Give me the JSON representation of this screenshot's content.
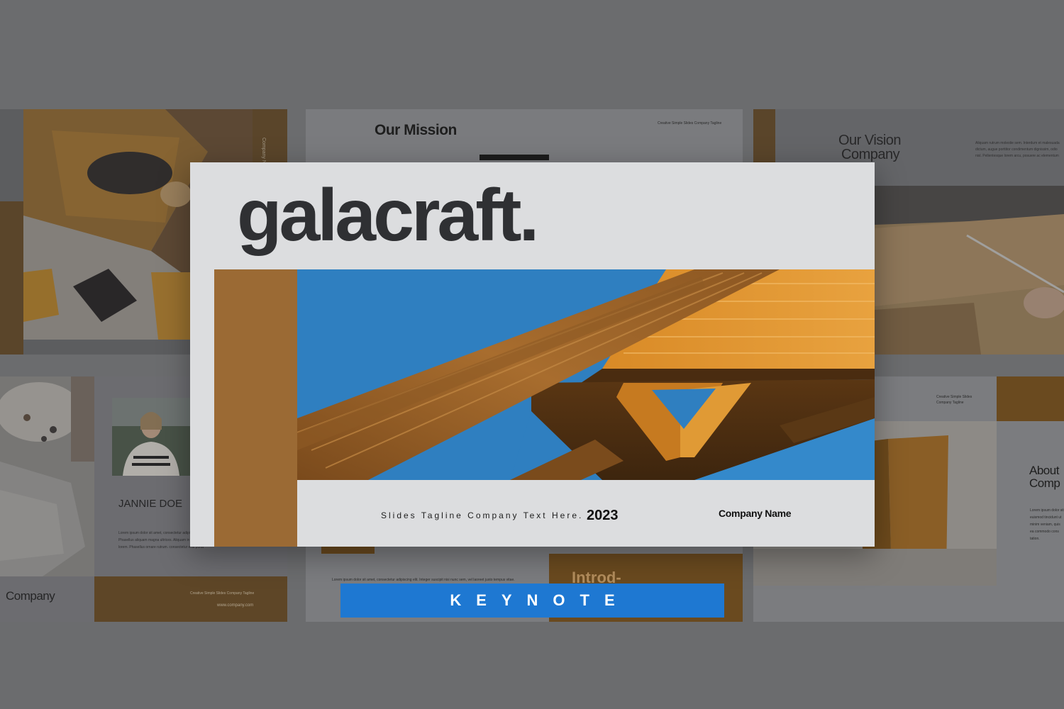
{
  "main_slide": {
    "brand": "galacraft.",
    "tagline": "Slides Tagline Company Text Here.",
    "year": "2023",
    "company_name": "Company Name"
  },
  "banner": {
    "label": "KEYNOTE"
  },
  "background_slides": {
    "top_left": {
      "side_label": "Company Name"
    },
    "top_center": {
      "title": "Our Mission",
      "tagline": "Creative Simple Slides Company Tagline"
    },
    "top_right": {
      "title_line1": "Our Vision",
      "title_line2": "Company",
      "body": "Aliquam rutrum molestie sem. Interdum et malesuada dictum, augue porttitor condimentum dignissim, odio nisl. Pellentesque lorem arcu, posuere ac elementum"
    },
    "bottom_left": {
      "person_name": "JANNIE DOE",
      "body": "Lorem ipsum dolor sit amet, consectetur adipiscing elit. laoreet justo tempus vitae. Phasellus aliquam magna ultrices. Aliquam in mi non neque vel nulla quis, pretium ultrices lorem. Phasellus ornare rutrum. consectetur erat porta",
      "company": "Company",
      "tagline": "Creative Simple Slides Company Tagline",
      "url": "www.company.com"
    },
    "bottom_center": {
      "body": "Lorem ipsum dolor sit amet, consectetur adipiscing elit. Integer suscipit nisi nunc sem, vel laoreet justo tempus vitae.",
      "heading": "Introd-"
    },
    "bottom_right": {
      "tagline": "Creative Simple Slides Company Tagline",
      "title_line1": "About",
      "title_line2": "Comp",
      "body": "Lorem ipsum dolor sit euismod tincidunt ut minim veniam, quis ea commodo cons tation."
    }
  },
  "colors": {
    "background": "#6b6c6e",
    "accent_brown": "#9b6a34",
    "banner_blue": "#1e78d2",
    "slide_bg": "#dcdddf"
  }
}
